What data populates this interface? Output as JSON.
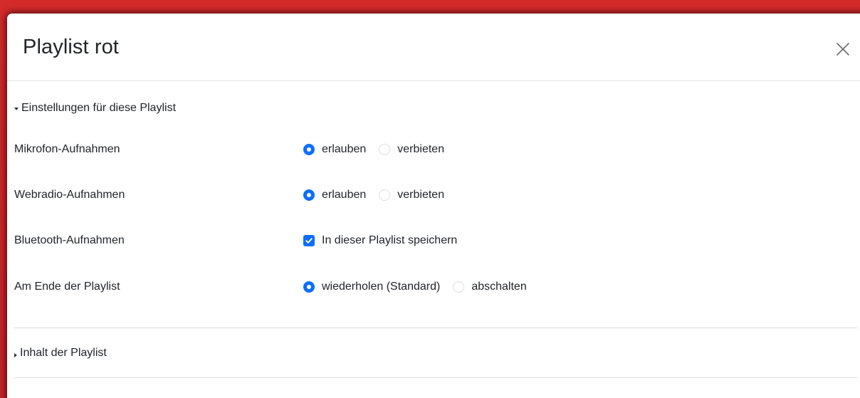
{
  "dialog": {
    "title": "Playlist rot",
    "close_icon": "close-icon"
  },
  "settings_section": {
    "label": "Einstellungen für diese Playlist",
    "expanded": true,
    "rows": [
      {
        "label": "Mikrofon-Aufnahmen",
        "options": [
          {
            "label": "erlauben",
            "selected": true
          },
          {
            "label": "verbieten",
            "selected": false
          }
        ]
      },
      {
        "label": "Webradio-Aufnahmen",
        "options": [
          {
            "label": "erlauben",
            "selected": true
          },
          {
            "label": "verbieten",
            "selected": false
          }
        ]
      },
      {
        "label": "Bluetooth-Aufnahmen",
        "checkbox": {
          "label": "In dieser Playlist speichern",
          "checked": true
        }
      },
      {
        "label": "Am Ende der Playlist",
        "options": [
          {
            "label": "wiederholen (Standard)",
            "selected": true
          },
          {
            "label": "abschalten",
            "selected": false
          }
        ]
      }
    ]
  },
  "content_section": {
    "label": "Inhalt der Playlist",
    "expanded": false
  },
  "colors": {
    "accent": "#0d6efd",
    "background_red": "#cf2328",
    "text": "#212529",
    "divider": "#dcdcdc"
  }
}
